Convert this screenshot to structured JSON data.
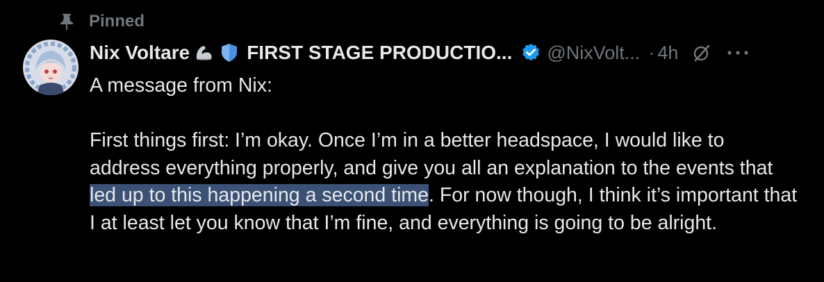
{
  "pinned": {
    "label": "Pinned"
  },
  "author": {
    "name": "Nix Voltare",
    "org": "FIRST STAGE PRODUCTIO...",
    "handle": "@NixVolt...",
    "separator": "·",
    "time": "4h"
  },
  "post": {
    "line1": "A message from Nix:",
    "p2_before": "First things first: I’m okay. Once I’m in a better headspace, I would like to address everything properly, and give you all an explanation to the events that ",
    "p2_highlight": "led up to this happening a second time",
    "p2_after": ". For now though, I think it’s important that I at least let you know that I’m fine, and everything is going to be alright."
  },
  "colors": {
    "background": "#000000",
    "text": "#e7e9ea",
    "secondary": "#71767b",
    "verified": "#1d9bf0",
    "highlight": "#3b5175"
  },
  "icons": {
    "pin": "pin-icon",
    "flexed_biceps": "flexed-biceps-emoji",
    "shield": "shield-emoji",
    "verified": "verified-badge-icon",
    "grok": "grok-icon",
    "more": "more-options-icon"
  }
}
